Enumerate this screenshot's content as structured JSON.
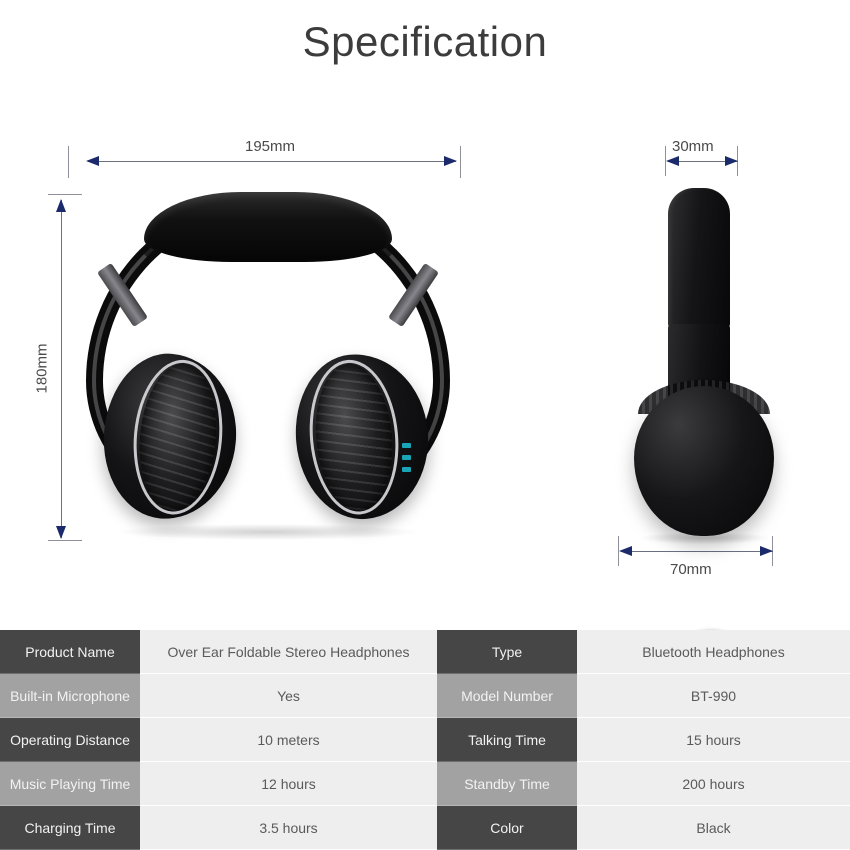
{
  "page": {
    "title": "Specification",
    "background": "#ffffff"
  },
  "colors": {
    "arrow": "#1b2a6b",
    "dimension_line": "#6b6f80",
    "label_dark": "#464646",
    "label_light": "#a2a2a2",
    "value_bg": "#eeeeee",
    "accent_control": "#19b6c8"
  },
  "dimensions": {
    "front_width": "195mm",
    "front_height": "180mm",
    "side_thickness": "30mm",
    "side_depth": "70mm"
  },
  "product_images": {
    "front_view": {
      "name": "front-view-headphones",
      "control_icons": [
        "volume-up-icon",
        "play-pause-icon",
        "volume-down-icon"
      ]
    },
    "side_view": {
      "name": "side-view-headphone",
      "plate_buttons": {
        "call": "⌒",
        "left": "◂",
        "right": "▸",
        "bottom": "▮▮"
      }
    }
  },
  "spec_table": {
    "rows": [
      {
        "label_left": "Product Name",
        "value_left": "Over Ear Foldable Stereo Headphones",
        "label_right": "Type",
        "value_right": "Bluetooth Headphones",
        "shade": "dark"
      },
      {
        "label_left": "Built-in Microphone",
        "value_left": "Yes",
        "label_right": "Model Number",
        "value_right": "BT-990",
        "shade": "light"
      },
      {
        "label_left": "Operating Distance",
        "value_left": "10 meters",
        "label_right": "Talking Time",
        "value_right": "15 hours",
        "shade": "dark"
      },
      {
        "label_left": "Music Playing Time",
        "value_left": "12 hours",
        "label_right": "Standby Time",
        "value_right": "200 hours",
        "shade": "light"
      },
      {
        "label_left": "Charging Time",
        "value_left": "3.5 hours",
        "label_right": "Color",
        "value_right": "Black",
        "shade": "dark"
      }
    ]
  }
}
